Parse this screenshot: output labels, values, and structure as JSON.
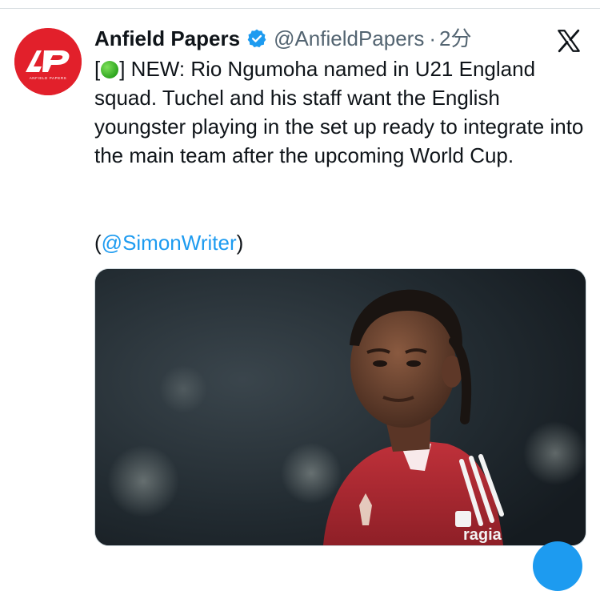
{
  "tweet": {
    "avatar_text": "AP",
    "avatar_subtext": "ANFIELD PAPERS",
    "author_name": "Anfield Papers",
    "handle": "@AnfieldPapers",
    "separator": "·",
    "timestamp": "2分",
    "text_prefix": "[",
    "text_body": "] NEW: Rio Ngumoha named in U21 England squad. Tuchel and his staff want the English youngster playing in the set up ready to integrate into the main team after the upcoming World Cup.",
    "credit_open": "(",
    "mention": "@SimonWriter",
    "credit_close": ")",
    "icons": [
      "verified-badge-icon",
      "x-logo-icon",
      "green-circle-emoji"
    ],
    "image_description_words": [
      "ragia"
    ]
  },
  "colors": {
    "brand_red": "#e2202b",
    "link_blue": "#1d9bf0",
    "text": "#0f1419",
    "secondary_text": "#536471"
  }
}
